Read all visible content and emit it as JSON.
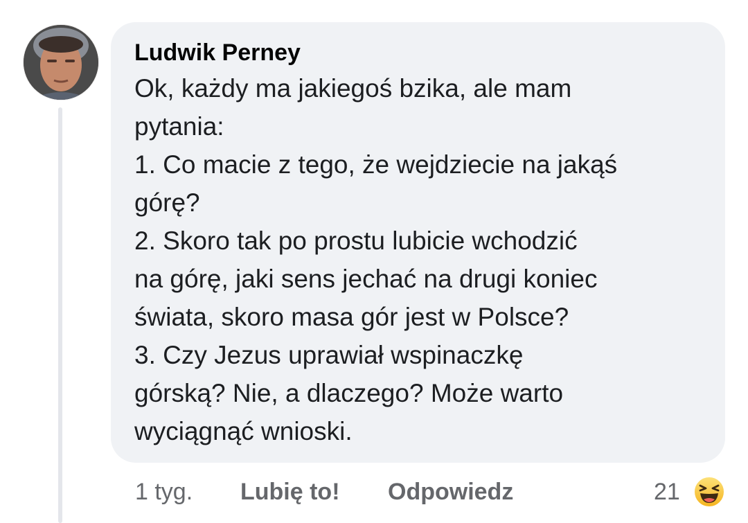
{
  "comment": {
    "author": "Ludwik Perney",
    "lines": [
      "Ok, każdy ma jakiegoś bzika, ale mam",
      "pytania:",
      "1. Co macie z tego, że wejdziecie na jakąś",
      "górę?",
      "2. Skoro tak po prostu lubicie wchodzić",
      "na górę, jaki sens jechać na drugi koniec",
      "świata, skoro masa gór jest w Polsce?",
      "3. Czy Jezus uprawiał wspinaczkę",
      "górską? Nie, a dlaczego? Może warto",
      "wyciągnąć wnioski."
    ]
  },
  "footer": {
    "time": "1 tyg.",
    "like_label": "Lubię to!",
    "reply_label": "Odpowiedz",
    "reaction_count": "21",
    "reaction_icon": "haha-emoji-icon"
  },
  "colors": {
    "bubble": "#f0f2f5",
    "meta_text": "#65676b",
    "reaction": "#f7b928"
  }
}
